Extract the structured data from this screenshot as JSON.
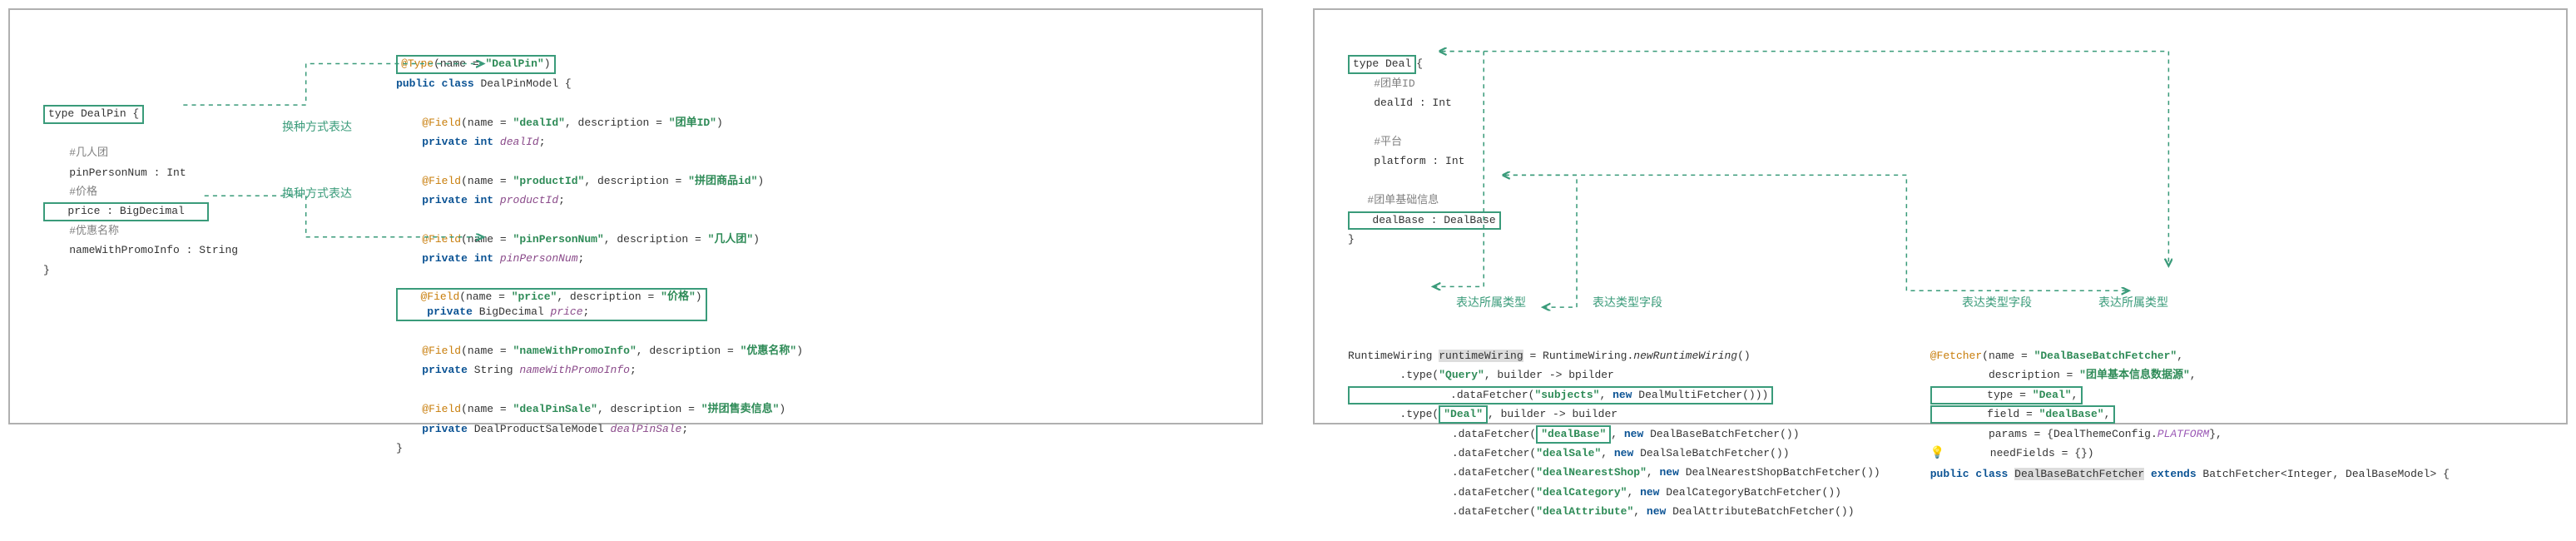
{
  "left_panel": {
    "schema": {
      "type_decl": "type DealPin {",
      "comment1": "#几人团",
      "field1": "pinPersonNum : Int",
      "comment2": "#价格",
      "field2": "price : BigDecimal",
      "comment3": "#优惠名称",
      "field3": "nameWithPromoInfo : String",
      "close": "}"
    },
    "label1": "换种方式表达",
    "label2": "换种方式表达",
    "java": {
      "type_anno": "@Type(name = \"DealPin\")",
      "class_decl": "public class DealPinModel {",
      "f1_anno": "@Field(name = \"dealId\", description = \"团单ID\")",
      "f1_decl": "private int dealId;",
      "f2_anno": "@Field(name = \"productId\", description = \"拼团商品id\")",
      "f2_decl": "private int productId;",
      "f3_anno": "@Field(name = \"pinPersonNum\", description = \"几人团\")",
      "f3_decl": "private int pinPersonNum;",
      "f4_anno": "@Field(name = \"price\", description = \"价格\")",
      "f4_decl": "private BigDecimal price;",
      "f5_anno": "@Field(name = \"nameWithPromoInfo\", description = \"优惠名称\")",
      "f5_decl": "private String nameWithPromoInfo;",
      "f6_anno": "@Field(name = \"dealPinSale\", description = \"拼团售卖信息\")",
      "f6_decl": "private DealProductSaleModel dealPinSale;",
      "close": "}"
    }
  },
  "right_panel": {
    "schema": {
      "type_decl": "type Deal{",
      "comment1": "#团单ID",
      "field1": "dealId : Int",
      "comment2": "#平台",
      "field2": "platform : Int",
      "comment3": "#团单基础信息",
      "field3": "dealBase : DealBase",
      "close": "}"
    },
    "label_type1": "表达所属类型",
    "label_field1": "表达类型字段",
    "label_field2": "表达类型字段",
    "label_type2": "表达所属类型",
    "wiring": {
      "l1": "RuntimeWiring runtimeWiring = RuntimeWiring.newRuntimeWiring()",
      "l2": "        .type(\"Query\", builder -> bpilder",
      "l3": "                .dataFetcher(\"subjects\", new DealMultiFetcher()))",
      "l4": "        .type(\"Deal\", builder -> builder",
      "l5": "                .dataFetcher(\"dealBase\", new DealBaseBatchFetcher())",
      "l6": "                .dataFetcher(\"dealSale\", new DealSaleBatchFetcher())",
      "l7": "                .dataFetcher(\"dealNearestShop\", new DealNearestShopBatchFetcher())",
      "l8": "                .dataFetcher(\"dealCategory\", new DealCategoryBatchFetcher())",
      "l9": "                .dataFetcher(\"dealAttribute\", new DealAttributeBatchFetcher())"
    },
    "fetcher": {
      "anno_l1": "@Fetcher(name = \"DealBaseBatchFetcher\",",
      "anno_l2": "         description = \"团单基本信息数据源\",",
      "anno_l3": "         type = \"Deal\",",
      "anno_l4": "         field = \"dealBase\",",
      "anno_l5": "         params = {DealThemeConfig.PLATFORM},",
      "anno_l6": "         needFields = {})",
      "class_decl": "public class DealBaseBatchFetcher extends BatchFetcher<Integer, DealBaseModel> {"
    }
  }
}
